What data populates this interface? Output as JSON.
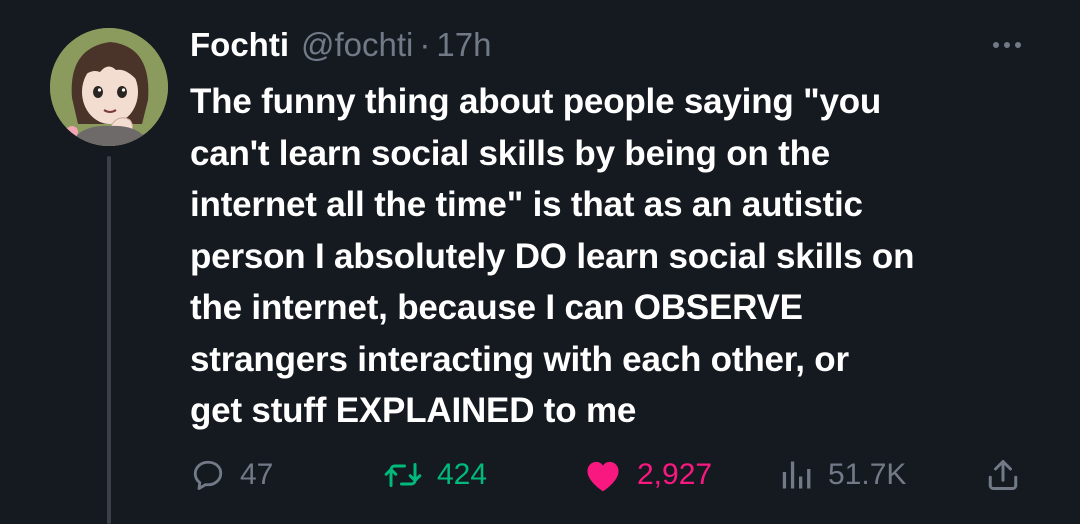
{
  "author": {
    "display_name": "Fochti",
    "handle": "@fochti",
    "separator": "·",
    "time": "17h"
  },
  "tweet": {
    "lines": [
      "The funny thing about people saying \"you",
      "can't learn social skills by being on the",
      "internet all the time\" is that as an autistic",
      "person I absolutely DO learn social skills on",
      "the internet, because I can OBSERVE",
      "strangers interacting with each other, or",
      "get stuff EXPLAINED to me"
    ]
  },
  "actions": {
    "replies": "47",
    "retweets": "424",
    "likes": "2,927",
    "views": "51.7K"
  },
  "icons": {
    "reply": "reply-bubble-icon",
    "retweet": "retweet-arrows-icon",
    "like": "heart-icon",
    "views": "bar-chart-icon",
    "share": "share-upload-icon",
    "more": "more-dots-icon"
  },
  "colors": {
    "background": "#151a21",
    "text": "#ffffff",
    "muted": "#717a86",
    "retweet": "#00ba7c",
    "like": "#f91880"
  }
}
